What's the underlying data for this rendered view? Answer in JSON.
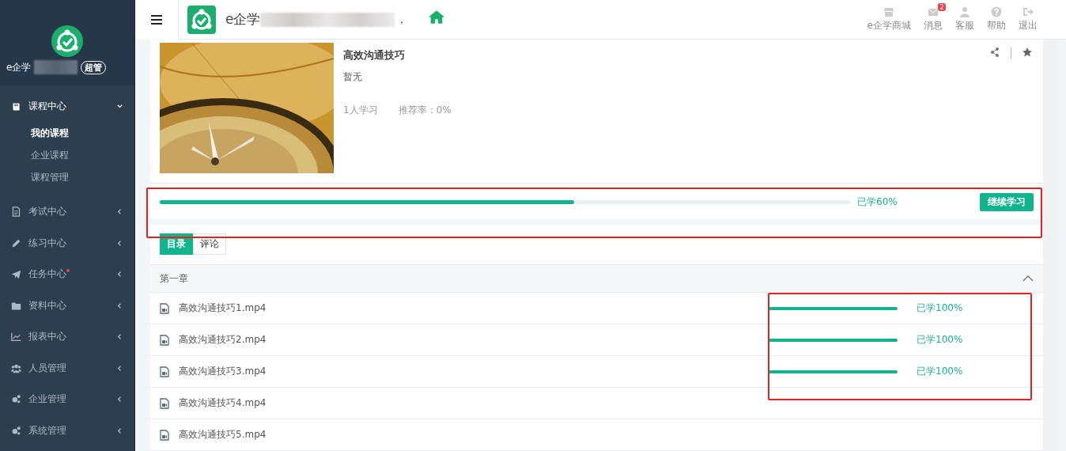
{
  "sidebar": {
    "brand": "e企学",
    "role_badge": "超管",
    "items": [
      {
        "label": "课程中心",
        "expanded": true,
        "badge_dot": false,
        "children": [
          {
            "label": "我的课程",
            "selected": true
          },
          {
            "label": "企业课程",
            "selected": false
          },
          {
            "label": "课程管理",
            "selected": false
          }
        ]
      },
      {
        "label": "考试中心",
        "expanded": false,
        "badge_dot": false
      },
      {
        "label": "练习中心",
        "expanded": false,
        "badge_dot": false
      },
      {
        "label": "任务中心",
        "expanded": false,
        "badge_dot": true
      },
      {
        "label": "资料中心",
        "expanded": false,
        "badge_dot": false
      },
      {
        "label": "报表中心",
        "expanded": false,
        "badge_dot": false
      },
      {
        "label": "人员管理",
        "expanded": false,
        "badge_dot": false
      },
      {
        "label": "企业管理",
        "expanded": false,
        "badge_dot": false
      },
      {
        "label": "系统管理",
        "expanded": false,
        "badge_dot": false
      }
    ]
  },
  "header": {
    "brand": "e企学",
    "brand_suffix": "，",
    "actions": [
      {
        "label": "e企学商城"
      },
      {
        "label": "消息",
        "badge": "2"
      },
      {
        "label": "客服"
      },
      {
        "label": "帮助"
      },
      {
        "label": "退出"
      }
    ]
  },
  "course": {
    "title": "高效沟通技巧",
    "description": "暂无",
    "learners": "1人学习",
    "recommend_rate": "推荐率：0%",
    "progress": {
      "level": 0.6,
      "reading": "已学60%"
    },
    "continue_button": "继续学习"
  },
  "tabs": [
    {
      "label": "目录",
      "selected": true
    },
    {
      "label": "评论",
      "selected": false
    }
  ],
  "chapter": {
    "title": "第一章",
    "expanded": true,
    "lessons": [
      {
        "name": "高效沟通技巧1.mp4",
        "level": 1,
        "reading": "已学100%"
      },
      {
        "name": "高效沟通技巧2.mp4",
        "level": 1,
        "reading": "已学100%"
      },
      {
        "name": "高效沟通技巧3.mp4",
        "level": 1,
        "reading": "已学100%"
      },
      {
        "name": "高效沟通技巧4.mp4"
      },
      {
        "name": "高效沟通技巧5.mp4"
      }
    ]
  }
}
